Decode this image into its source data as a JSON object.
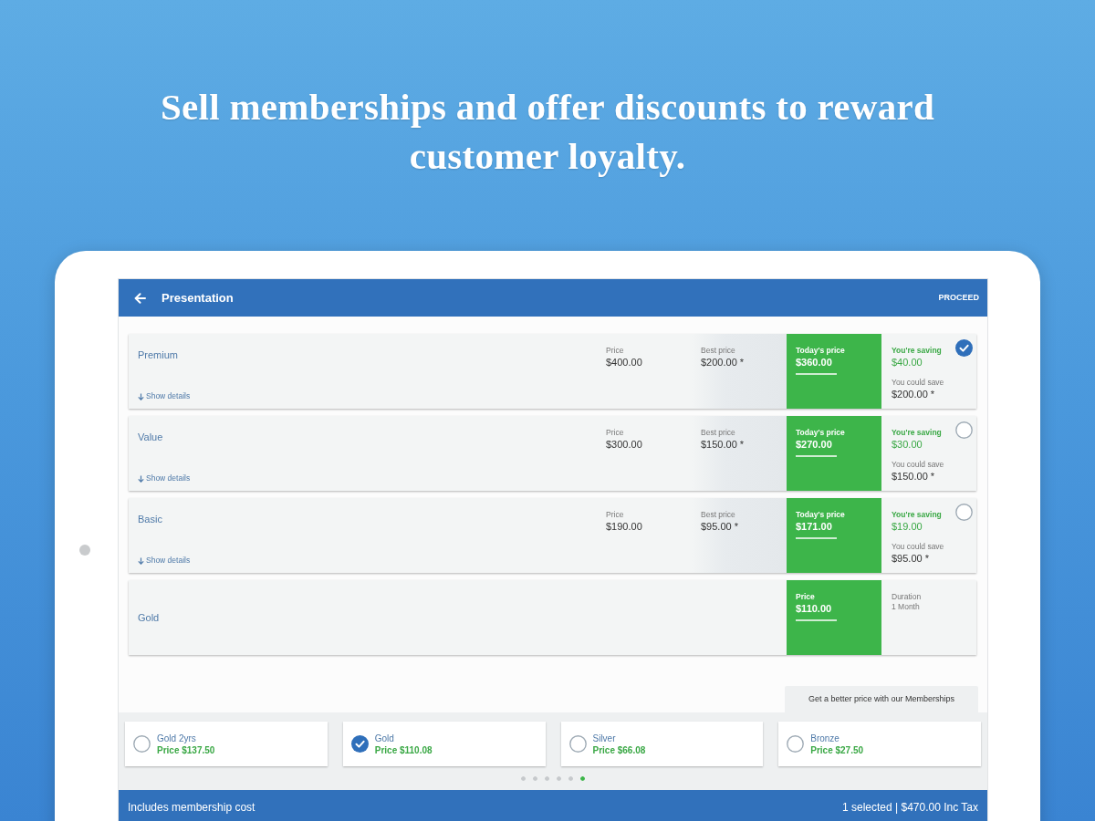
{
  "headline": "Sell memberships and offer discounts to reward customer loyalty.",
  "app_bar": {
    "title": "Presentation",
    "action": "PROCEED"
  },
  "plans": [
    {
      "kind": "discounted",
      "name": "Premium",
      "details_link": "Show details",
      "price_label": "Price",
      "price": "$400.00",
      "best_price_label": "Best price",
      "best_price": "$200.00 *",
      "todays_price_label": "Today's price",
      "todays_price": "$360.00",
      "saving_label": "You're saving",
      "saving": "$40.00",
      "could_save_label": "You could save",
      "could_save": "$200.00 *",
      "selected": true
    },
    {
      "kind": "discounted",
      "name": "Value",
      "details_link": "Show details",
      "price_label": "Price",
      "price": "$300.00",
      "best_price_label": "Best price",
      "best_price": "$150.00 *",
      "todays_price_label": "Today's price",
      "todays_price": "$270.00",
      "saving_label": "You're saving",
      "saving": "$30.00",
      "could_save_label": "You could save",
      "could_save": "$150.00 *",
      "selected": false
    },
    {
      "kind": "discounted",
      "name": "Basic",
      "details_link": "Show details",
      "price_label": "Price",
      "price": "$190.00",
      "best_price_label": "Best price",
      "best_price": "$95.00 *",
      "todays_price_label": "Today's price",
      "todays_price": "$171.00",
      "saving_label": "You're saving",
      "saving": "$19.00",
      "could_save_label": "You could save",
      "could_save": "$95.00 *",
      "selected": false
    },
    {
      "kind": "fixed",
      "name": "Gold",
      "price_label": "Price",
      "price": "$110.00",
      "duration_label": "Duration",
      "duration": "1 Month"
    }
  ],
  "memberships_tab": "Get a better price with our Memberships",
  "memberships": [
    {
      "name": "Gold 2yrs",
      "price": "Price $137.50",
      "selected": false
    },
    {
      "name": "Gold",
      "price": "Price $110.08",
      "selected": true
    },
    {
      "name": "Silver",
      "price": "Price $66.08",
      "selected": false
    },
    {
      "name": "Bronze",
      "price": "Price $27.50",
      "selected": false
    }
  ],
  "pager": [
    {
      "selected": false
    },
    {
      "selected": false
    },
    {
      "selected": false
    },
    {
      "selected": false
    },
    {
      "selected": false
    },
    {
      "selected": true
    }
  ],
  "footer": {
    "note": "Includes membership cost",
    "summary": "1 selected | $470.00 Inc Tax"
  }
}
